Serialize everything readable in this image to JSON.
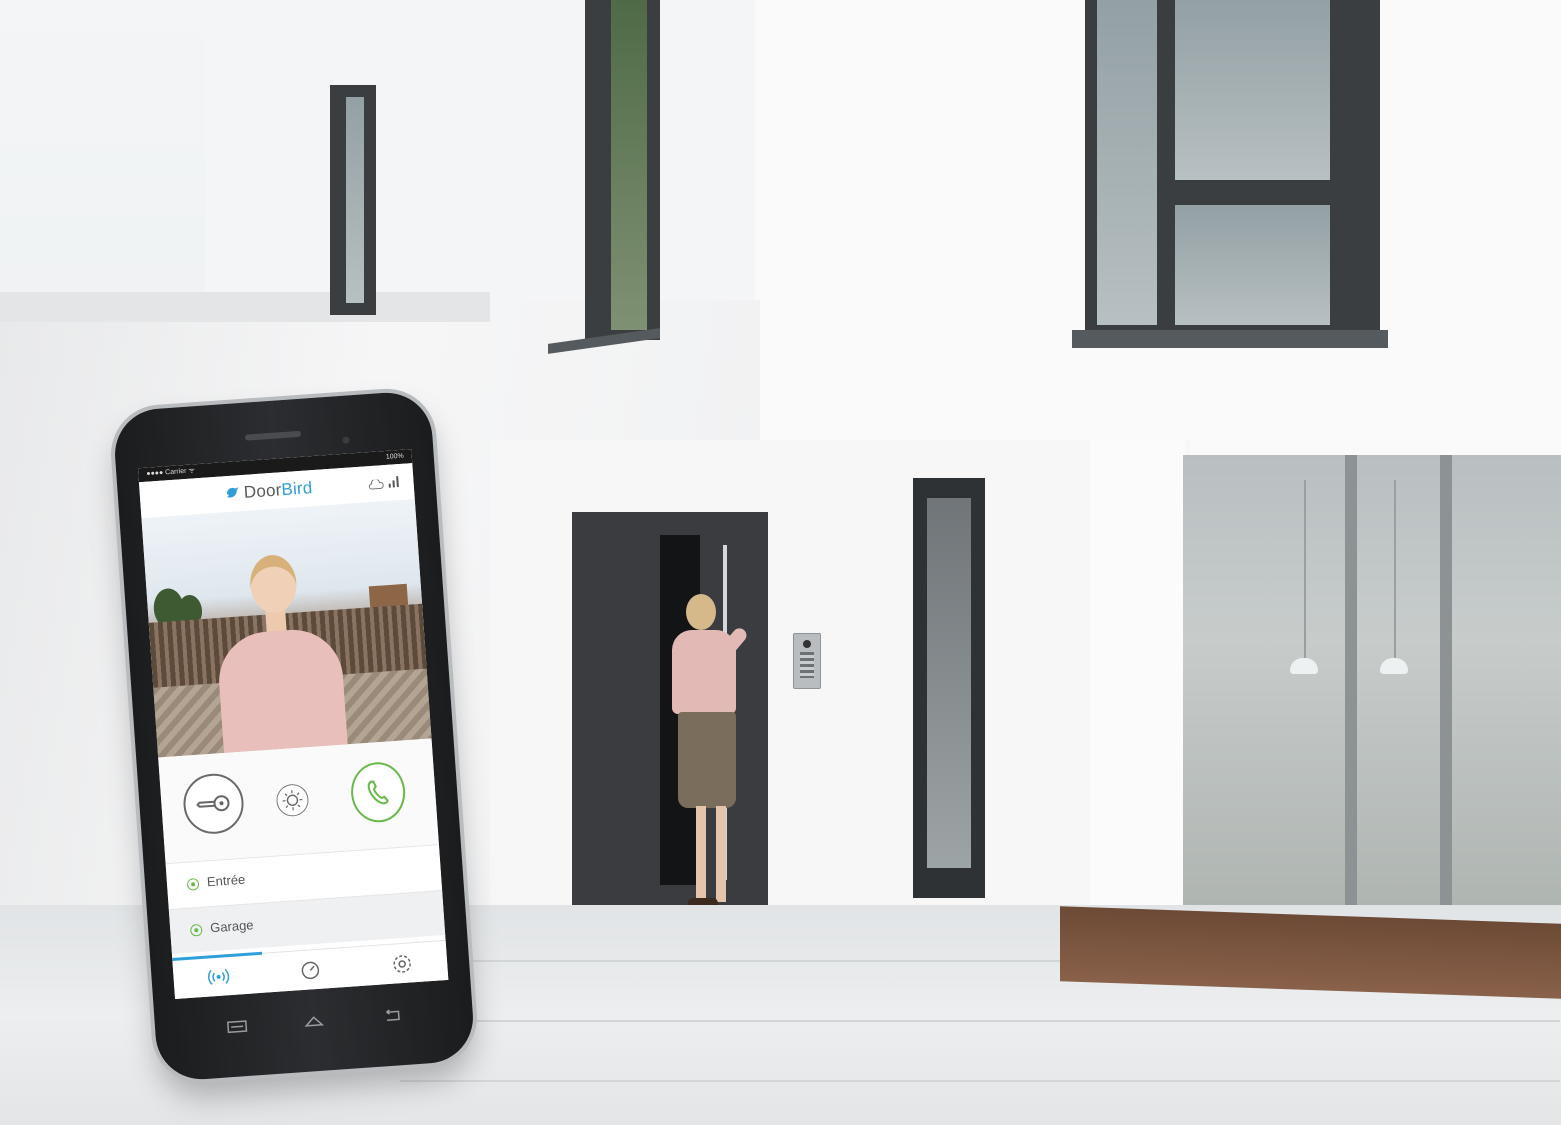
{
  "phone": {
    "status": {
      "carrier": "●●●● Carrier ᯤ",
      "battery": "100%"
    },
    "app": {
      "title_main": "Door",
      "title_accent": "Bird",
      "accent_color": "#2f9fd8",
      "call_color": "#67b94a"
    },
    "icons": {
      "logo": "bird-logo-icon",
      "cloud": "cloud-icon",
      "signal": "signal-icon",
      "unlock": "key-icon",
      "light": "light-icon",
      "call": "phone-icon",
      "tab_live": "broadcast-icon",
      "tab_history": "clock-icon",
      "tab_settings": "gear-icon"
    },
    "relays": [
      {
        "label": "Entrée"
      },
      {
        "label": "Garage"
      }
    ]
  }
}
